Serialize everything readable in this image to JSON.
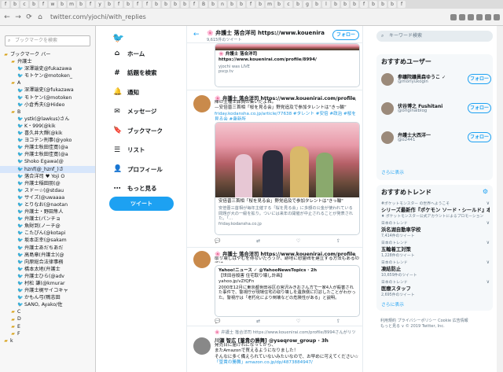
{
  "browser": {
    "url": "twitter.com/yjochi/with_replies",
    "tabs": [
      "f",
      "b",
      "c",
      "b",
      "f",
      "w",
      "b",
      "m",
      "b",
      "f",
      "y",
      "b",
      "f",
      "b",
      "f",
      "f",
      "b",
      "b",
      "b",
      "b",
      "f",
      "B",
      "b",
      "n",
      "b",
      "b",
      "f",
      "b",
      "m",
      "b",
      "c",
      "b",
      "g",
      "b",
      "l",
      "b",
      "b",
      "b",
      "f",
      "b",
      "b",
      "b",
      "f"
    ]
  },
  "sidebar": {
    "search_placeholder": "ブックマークを検索",
    "items": [
      {
        "label": "ブックマーク バー",
        "type": "folder",
        "indent": 0
      },
      {
        "label": "弁護士",
        "type": "folder",
        "indent": 1
      },
      {
        "label": "深澤諭史@fukazawa",
        "type": "bird",
        "indent": 2
      },
      {
        "label": "モトケン@motoken_",
        "type": "bird",
        "indent": 2
      },
      {
        "label": "A",
        "type": "folder",
        "indent": 1
      },
      {
        "label": "深澤諭史(@fukazawa",
        "type": "bird",
        "indent": 2
      },
      {
        "label": "モトケン(@motoken",
        "type": "bird",
        "indent": 2
      },
      {
        "label": "小倉秀夫(@Hideo",
        "type": "bird",
        "indent": 2
      },
      {
        "label": "B",
        "type": "folder",
        "indent": 1
      },
      {
        "label": "ystk(@lawkus)さん",
        "type": "bird",
        "indent": 2
      },
      {
        "label": "K・999(@kik",
        "type": "bird",
        "indent": 2
      },
      {
        "label": "喜久井大輝(@kik",
        "type": "bird",
        "indent": 2
      },
      {
        "label": "ヨコテン刑事(@yoko",
        "type": "bird",
        "indent": 2
      },
      {
        "label": "弁護士秋田佳寛(@a",
        "type": "bird",
        "indent": 2
      },
      {
        "label": "弁護士秋田佳寛(@a",
        "type": "bird",
        "indent": 2
      },
      {
        "label": "Shoko Egawa(@",
        "type": "bird",
        "indent": 2
      },
      {
        "label": "hznf(@_hznf_)さ",
        "type": "bird",
        "indent": 2,
        "selected": true
      },
      {
        "label": "落合洋司 ♥ Yoji O",
        "type": "bird",
        "indent": 2
      },
      {
        "label": "弁護士稲田朋(@",
        "type": "bird",
        "indent": 2
      },
      {
        "label": "スドー☆(@stdau",
        "type": "bird",
        "indent": 2
      },
      {
        "label": "サイズ(@uwaaaa",
        "type": "bird",
        "indent": 2
      },
      {
        "label": "とりなお(@naotan",
        "type": "bird",
        "indent": 2
      },
      {
        "label": "弁護士・野田隼人",
        "type": "bird",
        "indent": 2
      },
      {
        "label": "弁護士(パンチョ",
        "type": "bird",
        "indent": 2
      },
      {
        "label": "魚財到(ノーチ@",
        "type": "bird",
        "indent": 2
      },
      {
        "label": "こたぴん(@kotapi",
        "type": "bird",
        "indent": 2
      },
      {
        "label": "坂本正幸(@sakam",
        "type": "bird",
        "indent": 2
      },
      {
        "label": "弁護士あだちあだ",
        "type": "bird",
        "indent": 2
      },
      {
        "label": "高島章(弁護士)(@",
        "type": "bird",
        "indent": 2
      },
      {
        "label": "向原総合法律事務",
        "type": "bird",
        "indent": 2
      },
      {
        "label": "橋本太地(弁護士",
        "type": "bird",
        "indent": 2
      },
      {
        "label": "弁護士ひら(@adv",
        "type": "bird",
        "indent": 2
      },
      {
        "label": "村松 謙(@kmurar",
        "type": "bird",
        "indent": 2
      },
      {
        "label": "弁護士梶サイコキャ",
        "type": "bird",
        "indent": 2
      },
      {
        "label": "かもん弓(鴨志田",
        "type": "bird",
        "indent": 2
      },
      {
        "label": "SANO, Ayako/佐",
        "type": "bird",
        "indent": 2
      },
      {
        "label": "C",
        "type": "folder",
        "indent": 1
      },
      {
        "label": "D",
        "type": "folder",
        "indent": 1
      },
      {
        "label": "E",
        "type": "folder",
        "indent": 1
      },
      {
        "label": "F",
        "type": "folder",
        "indent": 1
      },
      {
        "label": "k",
        "type": "folder",
        "indent": 0
      }
    ]
  },
  "twitter_nav": {
    "items": [
      "ホーム",
      "話題を検索",
      "通知",
      "メッセージ",
      "ブックマーク",
      "リスト",
      "プロフィール",
      "もっと見る"
    ],
    "icons": [
      "home-icon",
      "hashtag-icon",
      "bell-icon",
      "mail-icon",
      "bookmark-icon",
      "list-icon",
      "person-icon",
      "more-icon"
    ],
    "tweet_button": "ツイート"
  },
  "timeline": {
    "header_title": "🌸 弁護士 落合洋司 https://www.kouenirai.com/profile/8994/",
    "header_sub": "9,615件のツイート",
    "follow": "フォロー",
    "tweet0": {
      "card_text": "🌸 弁護士 落合洋司 https://www.kouenirai.com/profile/8994/",
      "card_sub": "yjochi was LIVE",
      "card_domain": "pscp.tv"
    },
    "tweet1": {
      "name": "🌸 弁護士 落合洋司 https://www.kouenirai.com/profile/8994/",
      "text": "陣の主種士葬員の集いだよね。",
      "text2": "—安倍晋三首相「桜を見る会」野党追及で参加タレントは“きっ輪”",
      "link": "friday.kodansha.co.jp/article/77638 #タレント #安倍 #政治 #桜を見る会 #衆新所",
      "card_text": "安倍晋三首相「桜を見る会」野党追及で参加タレントは\"きっ輪\"",
      "card_sub": "安倍晋三首相が毎年主催する「桜を見る会」に多額の公金が使われている問題が大の一級を拡り。ついには来年の開催が中止されることが発表された。「…",
      "card_domain": "friday.kodansha.co.jp"
    },
    "tweet2": {
      "name": "🌸 弁護士 落合洋司 https://www.kouenirai.com/profile/8994/",
      "text": "取り壊しはやむを得ないだろうが、跡地に慰霊碑を建立する方法もあるのでは。",
      "quote_name": "Yahoo!ニュース ✓ @YahooNewsTopics · 2h",
      "quote_l1": "【世田谷殺害 住宅取り壊し計画】",
      "quote_l2": "yahoo.jp/vZfQFn",
      "quote_l3": "2000年12月に東京都世田谷区の宮沢みきおさん方で一家4人が殺害された事件で、警視庁が現場住宅の取り壊しを遺族側に打診したことがわかった。警視庁は「老朽化により倒壊などの危険性がある」と説明。"
    },
    "tweet3": {
      "retweet": "🌸 弁護士 落合洋司 https://www.kouenirai.com/profile/8994さんがリツイート",
      "name": "川瀬 智広 [篁貴の勝舞] @yseqrow_group · 3h",
      "text": "発売日に届けれになってから、",
      "text2": "またAmazonで買えるようになりました！",
      "text3": "そんなに多く備えられていないみたいなので、お早めに可えてください☆",
      "text4": "「篁貴の勝舞」amazon.co.jp/dp/4873884947/"
    }
  },
  "right": {
    "search_placeholder": "キーワード検索",
    "rec_title": "おすすめユーザー",
    "rec": [
      {
        "name": "参議院議員森ゆうこ ✓",
        "handle": "@moriyukogin"
      },
      {
        "name": "伏谷博之 Fushitani",
        "handle": "@originalblog"
      },
      {
        "name": "弁護士大西洋一",
        "handle": "@o2441"
      }
    ],
    "follow": "フォロー",
    "more": "さらに表示",
    "trend_title": "おすすめトレンド",
    "trends": [
      {
        "cat": "#ポケットモンスター の世界へようこそ",
        "name": "シリーズ最新作『ポケモン ソード・シールド』本日発売！",
        "count": "♦ ポケットモンスター公式アカウントによるプロモーション"
      },
      {
        "cat": "日本のトレンド",
        "name": "浜名湖自動車学校",
        "count": "7,414件のツイート"
      },
      {
        "cat": "日本のトレンド",
        "name": "五輪着工対策",
        "count": "1,228件のツイート"
      },
      {
        "cat": "日本のトレンド",
        "name": "凍結防止",
        "count": "10,659件のツイート"
      },
      {
        "cat": "日本のトレンド",
        "name": "医療スタッフ",
        "count": "2,695件のツイート"
      }
    ],
    "footer": [
      "利用規約 プライバシーポリシー Cookie 広告情報",
      "もっと見る ∨ © 2019 Twitter, Inc."
    ]
  }
}
